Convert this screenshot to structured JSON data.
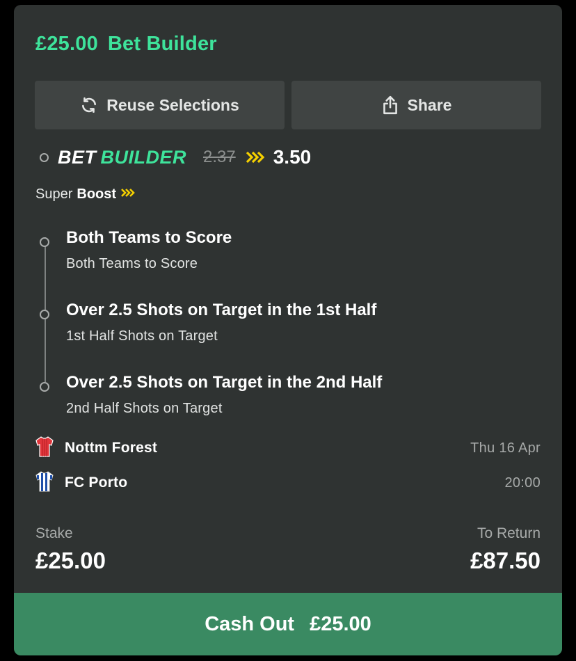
{
  "header": {
    "amount": "£25.00",
    "title": "Bet Builder"
  },
  "actions": {
    "reuse_label": "Reuse Selections",
    "share_label": "Share"
  },
  "bet_builder": {
    "logo_bet": "BET",
    "logo_builder": "BUILDER",
    "old_odds": "2.37",
    "new_odds": "3.50"
  },
  "boost": {
    "prefix": "Super",
    "label": "Boost"
  },
  "legs": [
    {
      "title": "Both Teams to Score",
      "market": "Both Teams to Score"
    },
    {
      "title": "Over 2.5 Shots on Target in the 1st Half",
      "market": "1st Half Shots on Target"
    },
    {
      "title": "Over 2.5 Shots on Target in the 2nd Half",
      "market": "2nd Half Shots on Target"
    }
  ],
  "event": {
    "home_team": "Nottm Forest",
    "away_team": "FC Porto",
    "date": "Thu 16 Apr",
    "time": "20:00"
  },
  "stake": {
    "label": "Stake",
    "value": "£25.00"
  },
  "to_return": {
    "label": "To Return",
    "value": "£87.50"
  },
  "cash_out": {
    "label": "Cash Out",
    "amount": "£25.00"
  },
  "colors": {
    "accent": "#3ee39b",
    "boost": "#f5d000",
    "cash_out_bg": "#3a8a62",
    "card_bg": "#2f3332"
  },
  "icons": {
    "reuse": "refresh-icon",
    "share": "share-icon",
    "boost": "double-chevron-icon",
    "home_kit": "red-shirt-icon",
    "away_kit": "striped-shirt-icon"
  }
}
